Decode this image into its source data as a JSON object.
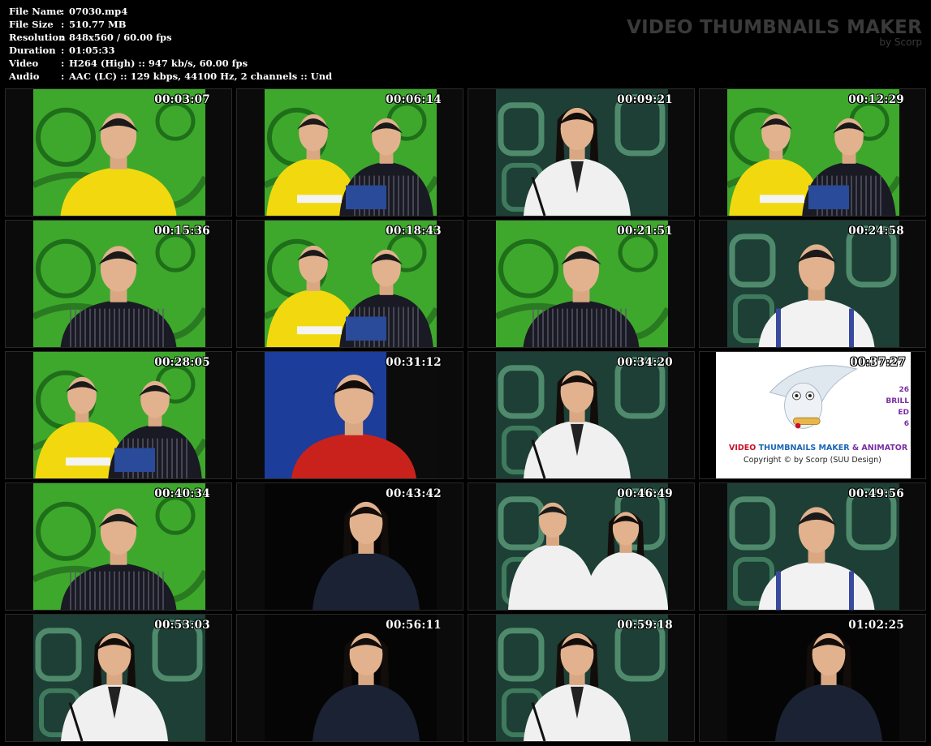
{
  "info": {
    "rows": [
      {
        "label": "File Name",
        "value": "07030.mp4"
      },
      {
        "label": "File Size",
        "value": "510.77 MB"
      },
      {
        "label": "Resolution",
        "value": "848x560 / 60.00 fps"
      },
      {
        "label": "Duration",
        "value": "01:05:33"
      },
      {
        "label": "Video",
        "value": "H264 (High) :: 947 kb/s, 60.00 fps"
      },
      {
        "label": "Audio",
        "value": "AAC (LC) :: 129 kbps, 44100 Hz, 2 channels :: Und"
      }
    ],
    "separator": ":"
  },
  "brand": {
    "title": "VIDEO THUMBNAILS MAKER",
    "subtitle": "by Scorp"
  },
  "thumbnails": [
    {
      "time": "00:03:07",
      "scene": "host-yellow"
    },
    {
      "time": "00:06:14",
      "scene": "two-hosts"
    },
    {
      "time": "00:09:21",
      "scene": "guest-woman-white"
    },
    {
      "time": "00:12:29",
      "scene": "two-hosts"
    },
    {
      "time": "00:15:36",
      "scene": "host-striped"
    },
    {
      "time": "00:18:43",
      "scene": "two-hosts"
    },
    {
      "time": "00:21:51",
      "scene": "host-striped"
    },
    {
      "time": "00:24:58",
      "scene": "guest-man-white"
    },
    {
      "time": "00:28:05",
      "scene": "two-hosts"
    },
    {
      "time": "00:31:12",
      "scene": "guest-woman-red"
    },
    {
      "time": "00:34:20",
      "scene": "guest-woman-white"
    },
    {
      "time": "00:37:27",
      "scene": "promo"
    },
    {
      "time": "00:40:34",
      "scene": "host-striped"
    },
    {
      "time": "00:43:42",
      "scene": "guest-woman-dark"
    },
    {
      "time": "00:46:49",
      "scene": "two-guests"
    },
    {
      "time": "00:49:56",
      "scene": "guest-man-white"
    },
    {
      "time": "00:53:03",
      "scene": "guest-woman-white"
    },
    {
      "time": "00:56:11",
      "scene": "guest-woman-dark"
    },
    {
      "time": "00:59:18",
      "scene": "guest-woman-white"
    },
    {
      "time": "01:02:25",
      "scene": "guest-woman-dark"
    }
  ],
  "promo": {
    "line1_red": "VIDEO ",
    "line1_blue": "THUMBNAILS MAKER ",
    "line1_purple": "& ANIMATOR",
    "line2": "Copyright © by Scorp (SUU Design)",
    "side": [
      "26",
      "BRILL",
      "ED",
      "6"
    ]
  },
  "colors": {
    "background": "#000000",
    "studio_green": "#3ea82c",
    "host_yellow": "#f2d90f",
    "guest_red": "#c9221c",
    "guest_white": "#eeeeee",
    "set_teal": "#1f5a48"
  }
}
